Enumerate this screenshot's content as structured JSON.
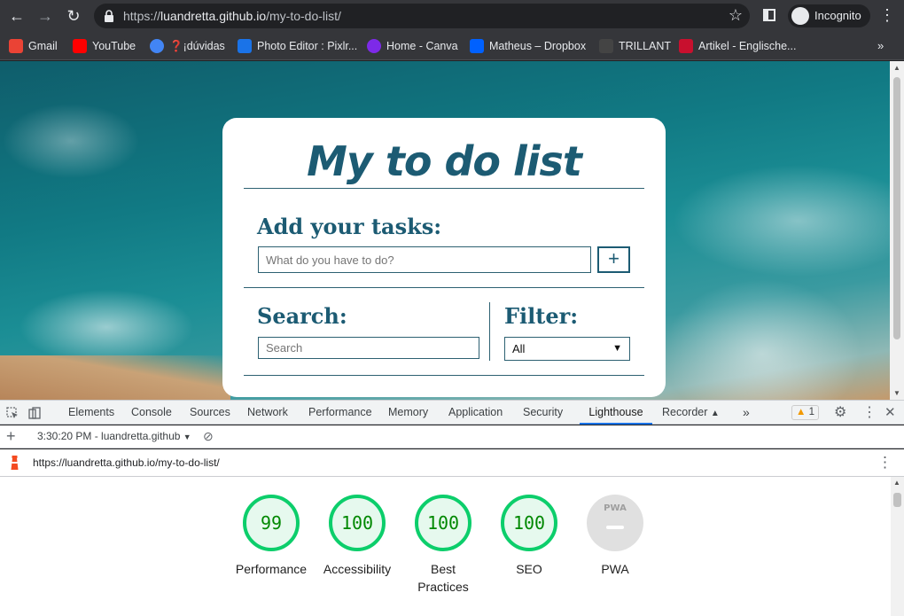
{
  "browser": {
    "url_domain": "luandretta.github.io",
    "url_path": "/my-to-do-list/",
    "url_scheme": "https://",
    "profile_label": "Incognito"
  },
  "bookmarks": [
    {
      "label": "Gmail",
      "color": "#ea4335"
    },
    {
      "label": "YouTube",
      "color": "#ff0000"
    },
    {
      "label": "❓¡dúvidas",
      "color": "#4285f4"
    },
    {
      "label": "Photo Editor : Pixlr...",
      "color": "#1a73e8"
    },
    {
      "label": "Home - Canva",
      "color": "#7d2ae8"
    },
    {
      "label": "Matheus – Dropbox",
      "color": "#0061ff"
    },
    {
      "label": "TRILLANT",
      "color": "#444444"
    },
    {
      "label": "Artikel - Englische...",
      "color": "#c8102e"
    }
  ],
  "app": {
    "title": "My to do list",
    "add_label": "Add your tasks:",
    "add_placeholder": "What do you have to do?",
    "add_button": "+",
    "search_label": "Search:",
    "search_placeholder": "Search",
    "filter_label": "Filter:",
    "filter_value": "All",
    "accent": "#1c5b73"
  },
  "devtools": {
    "tabs": [
      "Elements",
      "Console",
      "Sources",
      "Network",
      "Performance",
      "Memory",
      "Application",
      "Security",
      "Lighthouse",
      "Recorder"
    ],
    "active_tab": "Lighthouse",
    "warnings": "1",
    "report_selector": "3:30:20 PM - luandretta.github",
    "report_url": "https://luandretta.github.io/my-to-do-list/"
  },
  "lighthouse": {
    "scores": [
      {
        "label": "Performance",
        "value": "99"
      },
      {
        "label": "Accessibility",
        "value": "100"
      },
      {
        "label": "Best Practices",
        "value": "100"
      },
      {
        "label": "SEO",
        "value": "100"
      }
    ],
    "pwa_label": "PWA",
    "pwa_badge": "PWA",
    "pass_color": "#0cce6b"
  }
}
